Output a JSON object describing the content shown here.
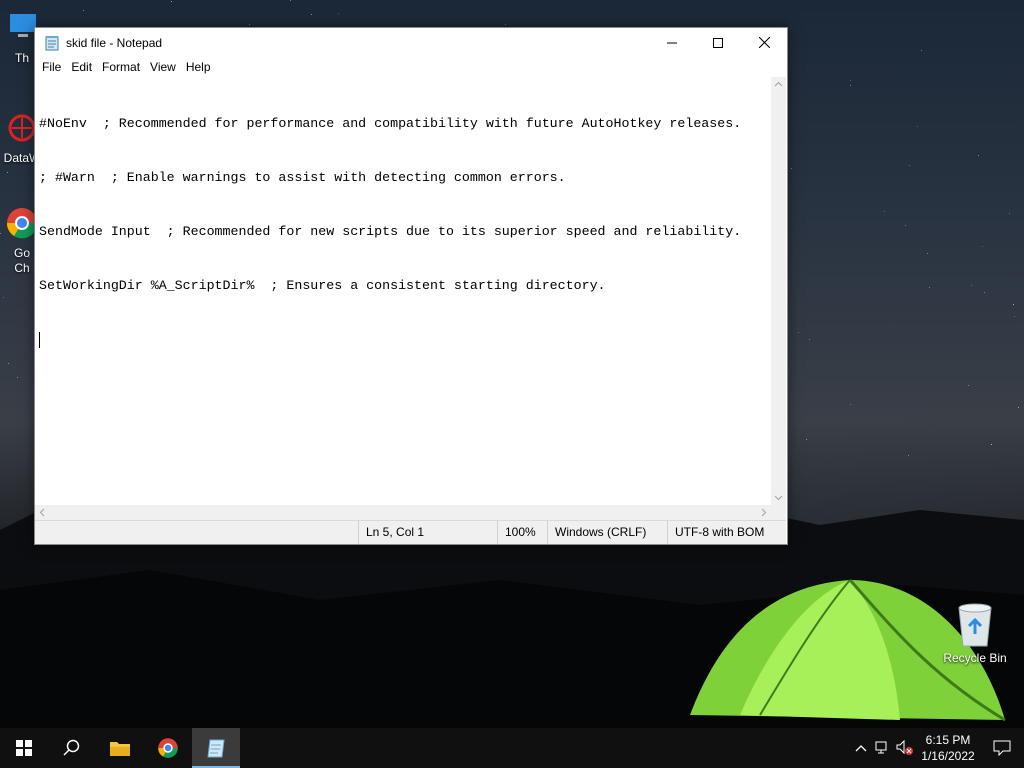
{
  "desktop": {
    "icons": [
      {
        "label": "Th"
      },
      {
        "label": "DataW"
      },
      {
        "label": "Go\nCh"
      }
    ],
    "recycle_bin": {
      "label": "Recycle Bin"
    }
  },
  "notepad": {
    "title": "skid file - Notepad",
    "menu": [
      "File",
      "Edit",
      "Format",
      "View",
      "Help"
    ],
    "lines": [
      "#NoEnv  ; Recommended for performance and compatibility with future AutoHotkey releases.",
      "; #Warn  ; Enable warnings to assist with detecting common errors.",
      "SendMode Input  ; Recommended for new scripts due to its superior speed and reliability.",
      "SetWorkingDir %A_ScriptDir%  ; Ensures a consistent starting directory."
    ],
    "status": {
      "position": "Ln 5, Col 1",
      "zoom": "100%",
      "line_ending": "Windows (CRLF)",
      "encoding": "UTF-8 with BOM"
    }
  },
  "taskbar": {
    "apps": [
      {
        "icon": "file-explorer-icon"
      },
      {
        "icon": "chrome-icon"
      },
      {
        "icon": "notepad-icon",
        "active": true
      }
    ],
    "clock": {
      "time": "6:15 PM",
      "date": "1/16/2022"
    }
  }
}
